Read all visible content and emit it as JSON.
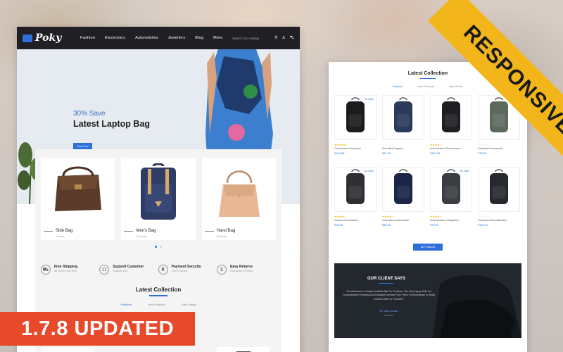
{
  "promo": {
    "ribbon": "RESPONSIVE",
    "badge": "1.7.8 UPDATED"
  },
  "colors": {
    "accent": "#2e6fd9",
    "ribbon": "#f2b61a",
    "badge": "#e74a2a",
    "nav_bg": "#1f1f24"
  },
  "header": {
    "logo_text": "Poky",
    "nav": [
      "Fashion",
      "Electronics",
      "Automobiles",
      "Jewellery",
      "Blog",
      "More"
    ],
    "search_placeholder": "Search our catalog",
    "icons": [
      "search-icon",
      "user-icon",
      "cart-icon"
    ]
  },
  "hero": {
    "kicker": "30% Save",
    "title": "Latest Laptop Bag",
    "button": "Shop Now"
  },
  "categories": [
    {
      "name": "Side Bag",
      "count": "6 Items"
    },
    {
      "name": "Men's Bag",
      "count": "15 Items"
    },
    {
      "name": "Hand Bag",
      "count": "20 Items"
    }
  ],
  "features": [
    {
      "title": "Free Shipping",
      "sub": "All Order Over $99",
      "icon": "truck-icon"
    },
    {
      "title": "Support Customer",
      "sub": "Support 24/7",
      "icon": "headset-icon"
    },
    {
      "title": "Payment Security",
      "sub": "100% Secure",
      "icon": "piggybank-icon"
    },
    {
      "title": "Easy Returns",
      "sub": "Exchange & Return",
      "icon": "return-icon"
    }
  ],
  "latest": {
    "title": "Latest Collection",
    "tabs": [
      "Featured",
      "New Products",
      "Best Sellers"
    ],
    "left_tabs": [
      "Featured",
      "New Products",
      "Best Selling"
    ]
  },
  "products": [
    {
      "name": "Consectetur Hampden",
      "price": "€104.86",
      "sale": "On Sale!",
      "rating": 5
    },
    {
      "name": "Exercitati Virginia",
      "price": "€87.00",
      "sale": "",
      "rating": 0
    },
    {
      "name": "Accusantium Doloremque",
      "price": "€115.00",
      "sale": "",
      "rating": 4
    },
    {
      "name": "Voluptas Accumenda",
      "price": "€78.00",
      "sale": "",
      "rating": 0
    },
    {
      "name": "Nostrud Exercitation",
      "price": "€98.00",
      "sale": "On Sale!",
      "rating": 4
    },
    {
      "name": "Convallis Consequatur",
      "price": "€85.00",
      "sale": "",
      "rating": 4
    },
    {
      "name": "Praesentium Voluptatum",
      "price": "€79.00",
      "sale": "On Sale!",
      "rating": 4
    },
    {
      "name": "Voluptates Repudiandae",
      "price": "€105.00",
      "sale": "",
      "rating": 0
    }
  ],
  "all_products_button": "All Products",
  "testimonial": {
    "title": "OUR CLIENT SAYS",
    "text": "\"Furnitureneuse Is Really Excellent Site For Furniture. I Am Very Happy With The Furnitureneuse Products And Dedicated Services From Them. Furnitureneuse Is Really Excellent Site For Furniture.\"",
    "name": "Mr. Mark Jordan",
    "role": "Developer"
  }
}
